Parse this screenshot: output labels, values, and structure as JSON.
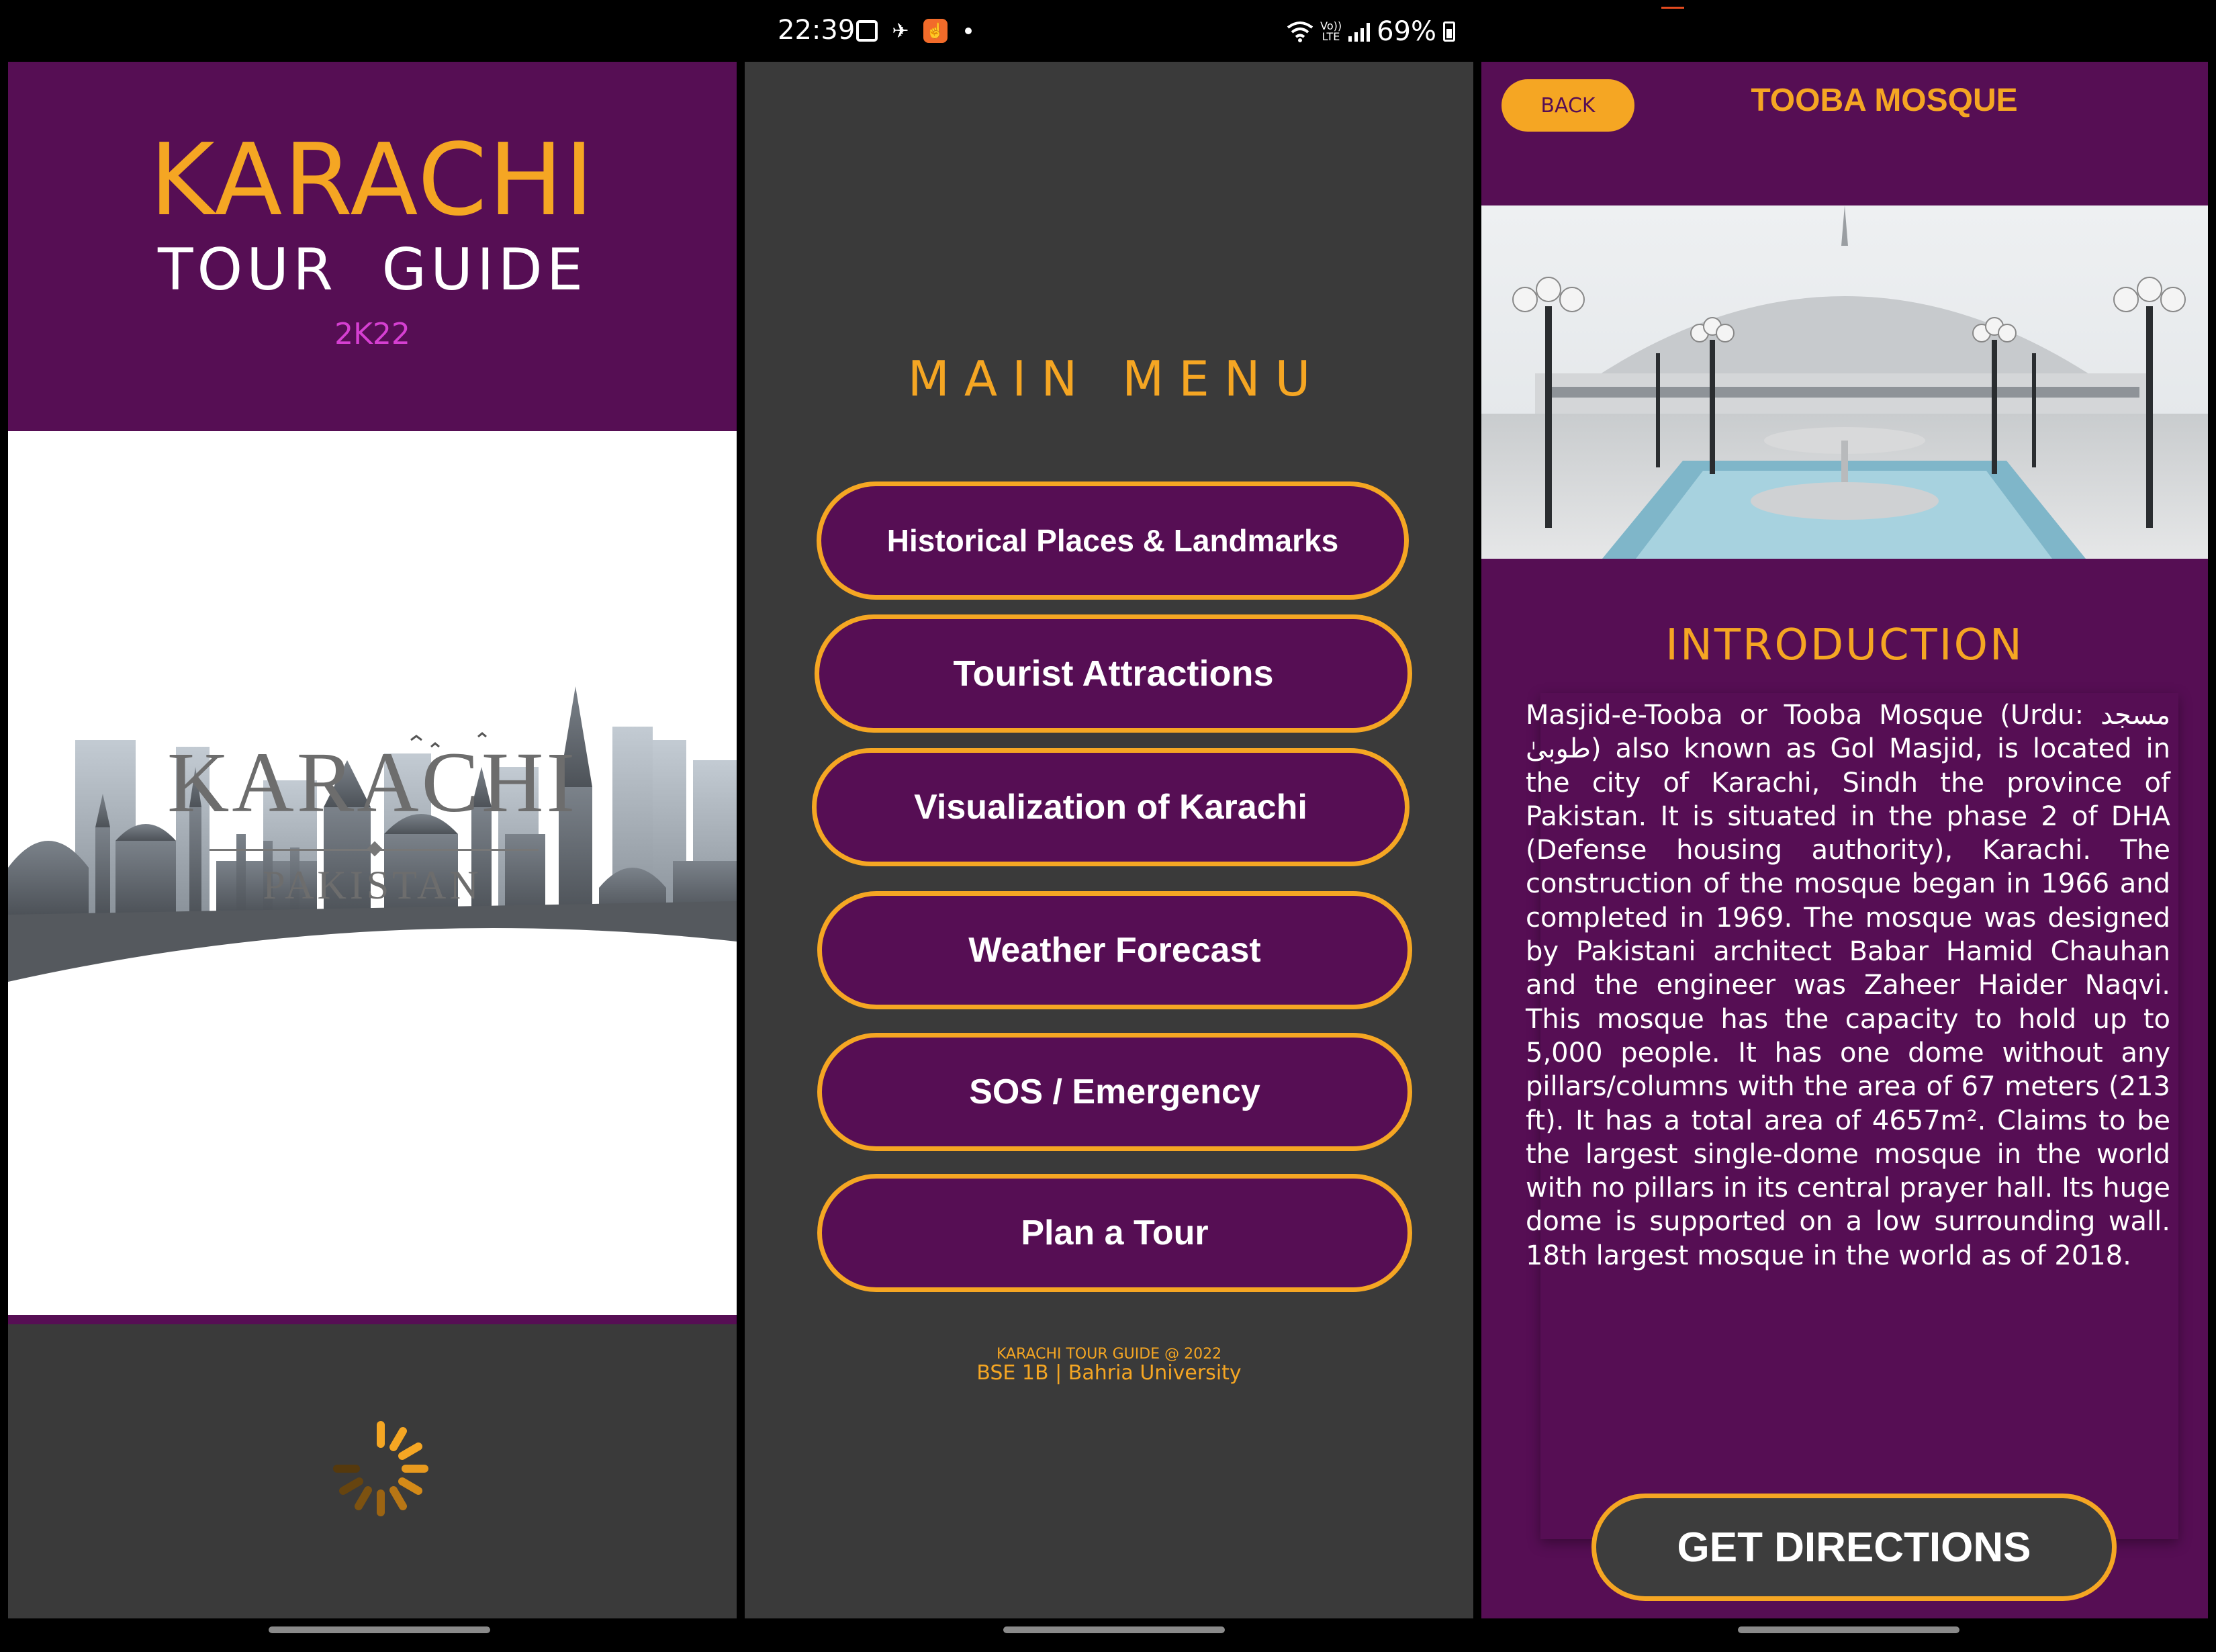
{
  "status_bar": {
    "time": "22:39",
    "battery": "69%",
    "volte_line1": "Vo))",
    "volte_line2": "LTE",
    "icons": [
      "gallery-icon",
      "airplane-icon",
      "app-notification-icon",
      "dot-icon",
      "wifi-icon",
      "volte-icon",
      "signal-icon",
      "battery-icon"
    ]
  },
  "splash": {
    "title": "KARACHI",
    "subtitle": "TOUR  GUIDE",
    "year": "2K22",
    "logo_title": "KARACHI",
    "logo_subtitle": "PAKISTAN",
    "colors": {
      "header": "#560e54",
      "accent": "#f5a623",
      "year": "#d63fd2"
    }
  },
  "main_menu": {
    "title": "MAIN MENU",
    "items": [
      {
        "label": "Historical Places & Landmarks"
      },
      {
        "label": "Tourist Attractions"
      },
      {
        "label": "Visualization of Karachi"
      },
      {
        "label": "Weather Forecast"
      },
      {
        "label": "SOS / Emergency"
      },
      {
        "label": "Plan a Tour"
      }
    ],
    "footer_line1": "KARACHI TOUR GUIDE @ 2022",
    "footer_line2": "BSE 1B | Bahria University"
  },
  "detail": {
    "back_label": "BACK",
    "title": "TOOBA MOSQUE",
    "intro_heading": "INTRODUCTION",
    "intro_text": "Masjid-e-Tooba or Tooba Mosque (Urdu: مسجد طوبیٰ) also known as Gol Masjid, is located in the city of Karachi, Sindh the province of Pakistan. It is situated in the phase 2 of DHA (Defense housing authority), Karachi.  The construction of the mosque began in 1966 and completed in 1969. The mosque was designed by Pakistani architect Babar Hamid Chauhan and the engineer was Zaheer Haider Naqvi. This mosque has the capacity to hold up to 5,000 people. It has one dome without any pillars/columns with the area of 67 meters (213 ft). It has a total area of 4657m². Claims to be the largest single-dome mosque in the world with no pillars in its central prayer hall. Its huge dome is supported on a low surrounding wall. 18th largest mosque in the world as of 2018.",
    "directions_label": "GET DIRECTIONS"
  }
}
